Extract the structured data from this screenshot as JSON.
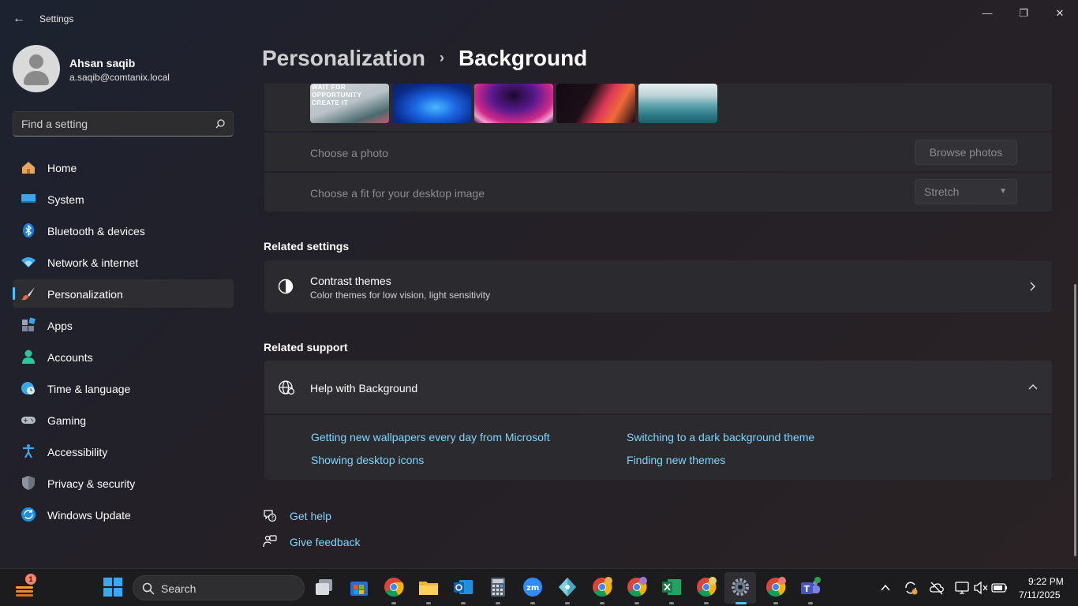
{
  "window": {
    "title": "Settings",
    "minimize": "—",
    "maximize": "❐",
    "close": "✕",
    "back": "←"
  },
  "profile": {
    "name": "Ahsan saqib",
    "email": "a.saqib@comtanix.local"
  },
  "search": {
    "placeholder": "Find a setting"
  },
  "sidebar": {
    "items": [
      {
        "label": "Home",
        "icon": "home-icon"
      },
      {
        "label": "System",
        "icon": "monitor-icon"
      },
      {
        "label": "Bluetooth & devices",
        "icon": "bluetooth-icon"
      },
      {
        "label": "Network & internet",
        "icon": "wifi-icon"
      },
      {
        "label": "Personalization",
        "icon": "brush-icon",
        "active": true
      },
      {
        "label": "Apps",
        "icon": "apps-icon"
      },
      {
        "label": "Accounts",
        "icon": "person-icon"
      },
      {
        "label": "Time & language",
        "icon": "globe-clock-icon"
      },
      {
        "label": "Gaming",
        "icon": "gamepad-icon"
      },
      {
        "label": "Accessibility",
        "icon": "accessibility-icon"
      },
      {
        "label": "Privacy & security",
        "icon": "shield-icon"
      },
      {
        "label": "Windows Update",
        "icon": "update-icon"
      }
    ]
  },
  "breadcrumb": {
    "parent": "Personalization",
    "separator": "›",
    "current": "Background"
  },
  "thumb_text": "WAIT FOR\nOPPORTUNITY\nCREATE IT",
  "background_card": {
    "choose_photo_label": "Choose a photo",
    "browse_button": "Browse photos",
    "fit_label": "Choose a fit for your desktop image",
    "fit_value": "Stretch"
  },
  "related_settings": {
    "title": "Related settings",
    "contrast_title": "Contrast themes",
    "contrast_sub": "Color themes for low vision, light sensitivity"
  },
  "related_support": {
    "title": "Related support",
    "help_title": "Help with Background",
    "links": [
      "Getting new wallpapers every day from Microsoft",
      "Switching to a dark background theme",
      "Showing desktop icons",
      "Finding new themes"
    ]
  },
  "footer_links": {
    "get_help": "Get help",
    "give_feedback": "Give feedback"
  },
  "taskbar": {
    "search_label": "Search",
    "time": "9:22 PM",
    "date": "7/11/2025",
    "notification_count": "1"
  },
  "colors": {
    "accent": "#4cc2ff",
    "link": "#7fd6ff",
    "card": "#2b2a2e"
  }
}
